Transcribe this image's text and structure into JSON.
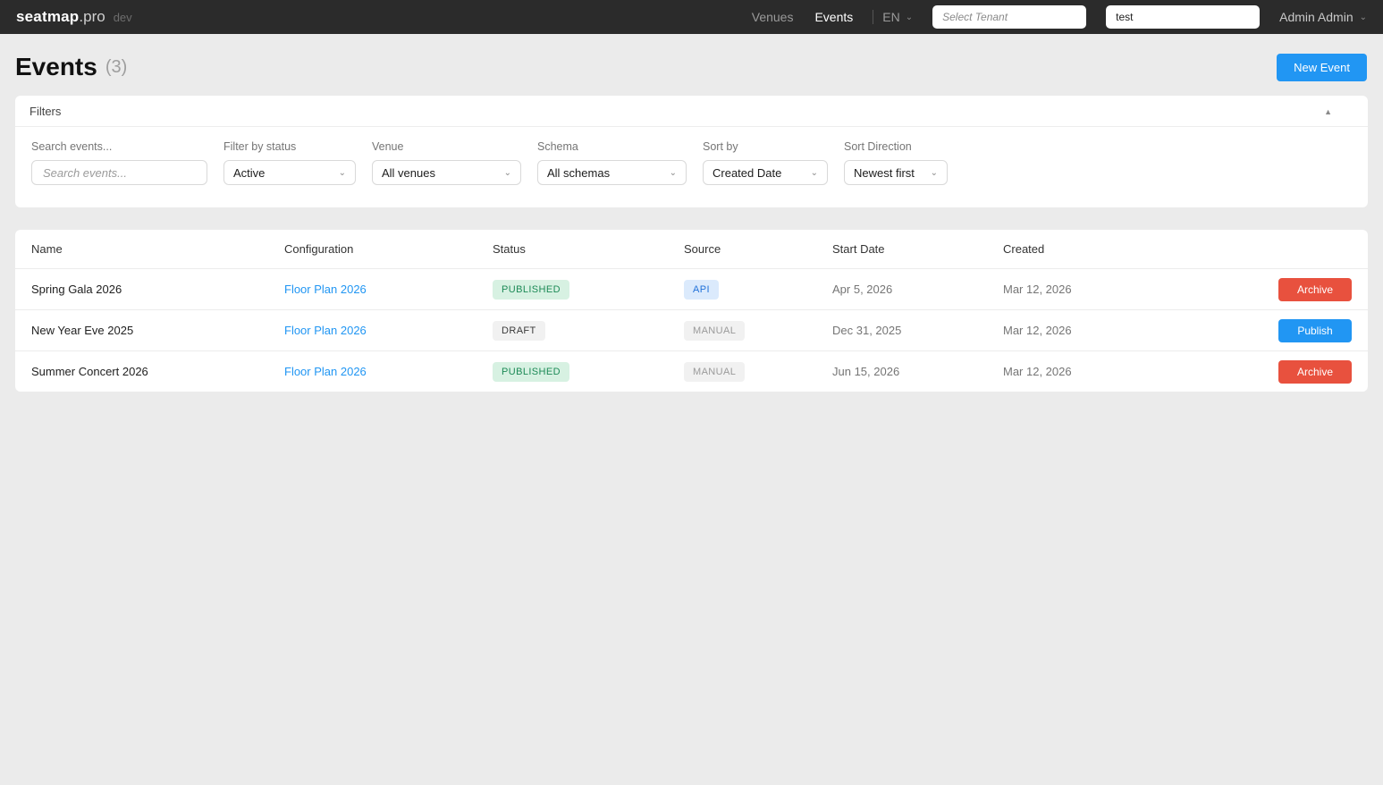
{
  "navbar": {
    "brand": {
      "name": "seatmap",
      "suffix": ".pro",
      "env": "dev"
    },
    "links": [
      {
        "label": "Venues",
        "active": false
      },
      {
        "label": "Events",
        "active": true
      }
    ],
    "language": "EN",
    "tenant_placeholder": "Select Tenant",
    "search_value": "test",
    "user": "Admin Admin"
  },
  "icons": {
    "chevron_down": "⌄",
    "collapse_up": "▲"
  },
  "header": {
    "title": "Events",
    "count": "(3)",
    "new_event_label": "New Event"
  },
  "filters": {
    "title": "Filters",
    "search": {
      "label": "Search events...",
      "placeholder": "Search events..."
    },
    "selects": [
      {
        "label": "Filter by status",
        "value": "Active"
      },
      {
        "label": "Venue",
        "value": "All venues"
      },
      {
        "label": "Schema",
        "value": "All schemas"
      },
      {
        "label": "Sort by",
        "value": "Created Date"
      },
      {
        "label": "Sort Direction",
        "value": "Newest first"
      }
    ]
  },
  "table": {
    "columns": [
      "Name",
      "Configuration",
      "Status",
      "Source",
      "Start Date",
      "Created"
    ],
    "rows": [
      {
        "name": "Spring Gala 2026",
        "configuration": "Floor Plan 2026",
        "status": "PUBLISHED",
        "status_type": "published",
        "source": "API",
        "source_type": "api",
        "start_date": "Apr 5, 2026",
        "created": "Mar 12, 2026",
        "action": "Archive",
        "action_type": "archive"
      },
      {
        "name": "New Year Eve 2025",
        "configuration": "Floor Plan 2026",
        "status": "DRAFT",
        "status_type": "draft",
        "source": "MANUAL",
        "source_type": "manual",
        "start_date": "Dec 31, 2025",
        "created": "Mar 12, 2026",
        "action": "Publish",
        "action_type": "publish"
      },
      {
        "name": "Summer Concert 2026",
        "configuration": "Floor Plan 2026",
        "status": "PUBLISHED",
        "status_type": "published",
        "source": "MANUAL",
        "source_type": "manual",
        "start_date": "Jun 15, 2026",
        "created": "Mar 12, 2026",
        "action": "Archive",
        "action_type": "archive"
      }
    ]
  },
  "colors": {
    "navbar_bg": "#2b2b2b",
    "page_bg": "#ebebeb",
    "accent_blue": "#2196f3",
    "danger_red": "#e8513e",
    "published_bg": "#d7f1e2",
    "published_text": "#1d8a57",
    "api_bg": "#dbeafc",
    "api_text": "#2272d9",
    "muted_badge_bg": "#f1f1f1"
  }
}
